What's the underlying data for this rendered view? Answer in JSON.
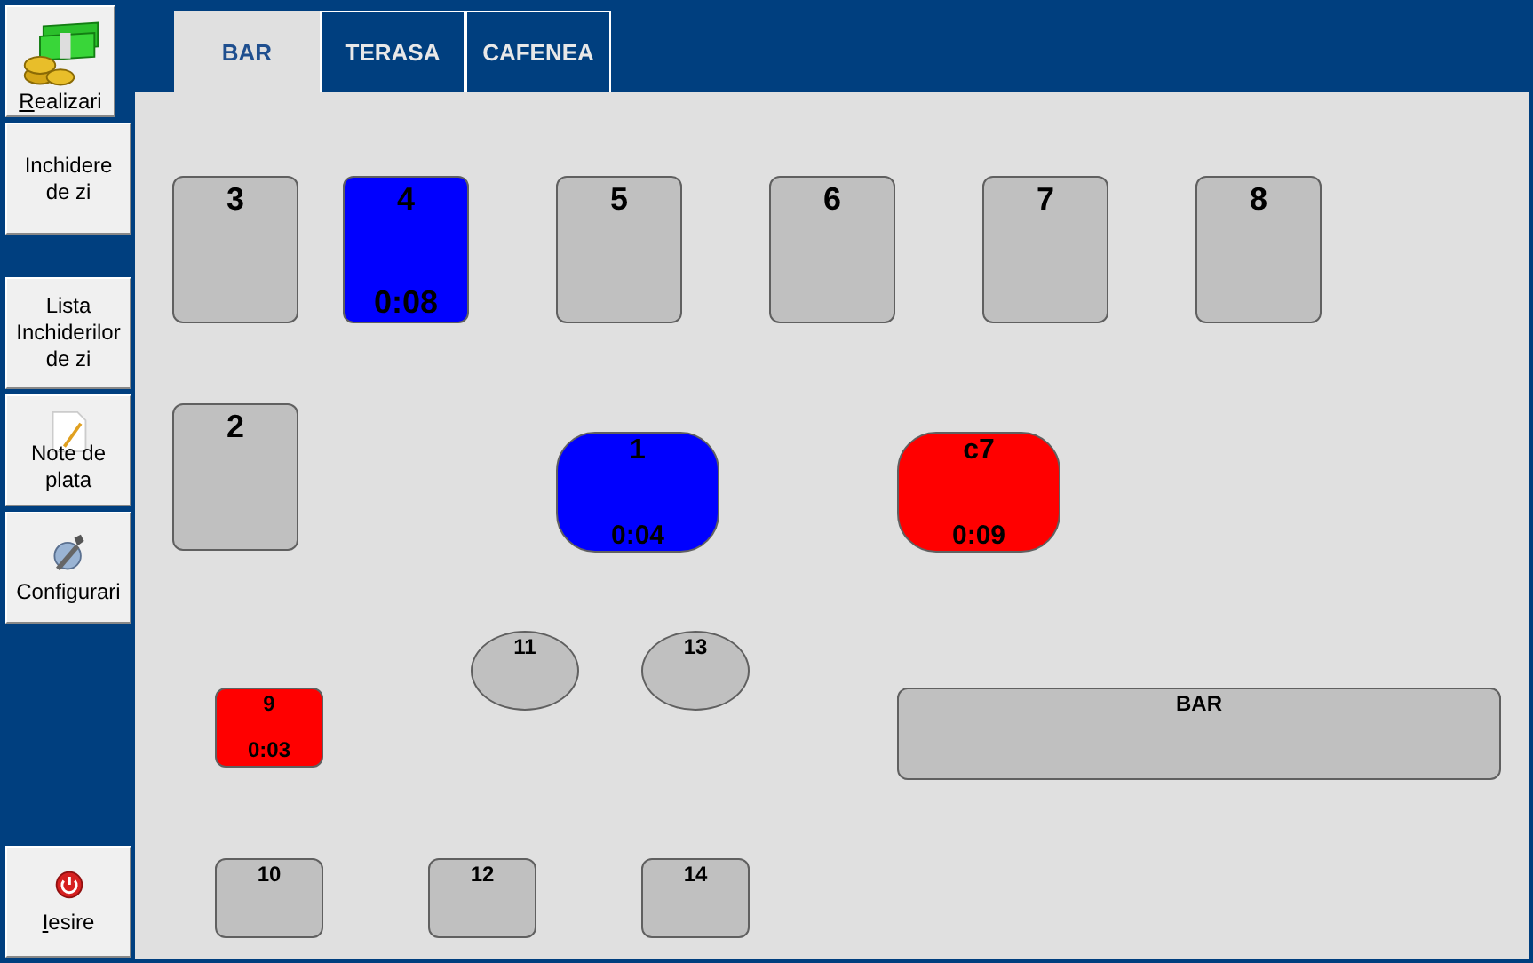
{
  "sidebar": {
    "items": [
      {
        "label": "Realizari",
        "accesskey": true
      },
      {
        "label": "Inchidere de zi",
        "accesskey": false
      },
      {
        "label": "Lista Inchiderilor de zi",
        "accesskey": false
      },
      {
        "label": "Note de plata",
        "accesskey": false
      },
      {
        "label": "Configurari",
        "accesskey": false
      },
      {
        "label": "Iesire",
        "accesskey": true
      }
    ]
  },
  "tabs": [
    {
      "label": "BAR",
      "selected": true
    },
    {
      "label": "TERASA",
      "selected": false
    },
    {
      "label": "CAFENEA",
      "selected": false
    }
  ],
  "tables": [
    {
      "label": "3",
      "kind": "square",
      "color": "#c0c0c0"
    },
    {
      "label": "4",
      "time": "0:08",
      "kind": "square",
      "color": "#0000ff"
    },
    {
      "label": "5",
      "kind": "square",
      "color": "#c0c0c0"
    },
    {
      "label": "6",
      "kind": "square",
      "color": "#c0c0c0"
    },
    {
      "label": "7",
      "kind": "square",
      "color": "#c0c0c0"
    },
    {
      "label": "8",
      "kind": "square",
      "color": "#c0c0c0"
    },
    {
      "label": "2",
      "kind": "square",
      "color": "#c0c0c0"
    },
    {
      "label": "1",
      "time": "0:04",
      "kind": "rounded",
      "color": "#0000ff"
    },
    {
      "label": "c7",
      "time": "0:09",
      "kind": "rounded",
      "color": "#ff0000"
    },
    {
      "label": "11",
      "kind": "oval",
      "color": "#c0c0c0"
    },
    {
      "label": "13",
      "kind": "oval",
      "color": "#c0c0c0"
    },
    {
      "label": "9",
      "time": "0:03",
      "kind": "small",
      "color": "#ff0000"
    },
    {
      "label": "BAR",
      "kind": "counter",
      "color": "#c0c0c0"
    },
    {
      "label": "10",
      "kind": "small",
      "color": "#c0c0c0"
    },
    {
      "label": "12",
      "kind": "small",
      "color": "#c0c0c0"
    },
    {
      "label": "14",
      "kind": "small",
      "color": "#c0c0c0"
    }
  ]
}
